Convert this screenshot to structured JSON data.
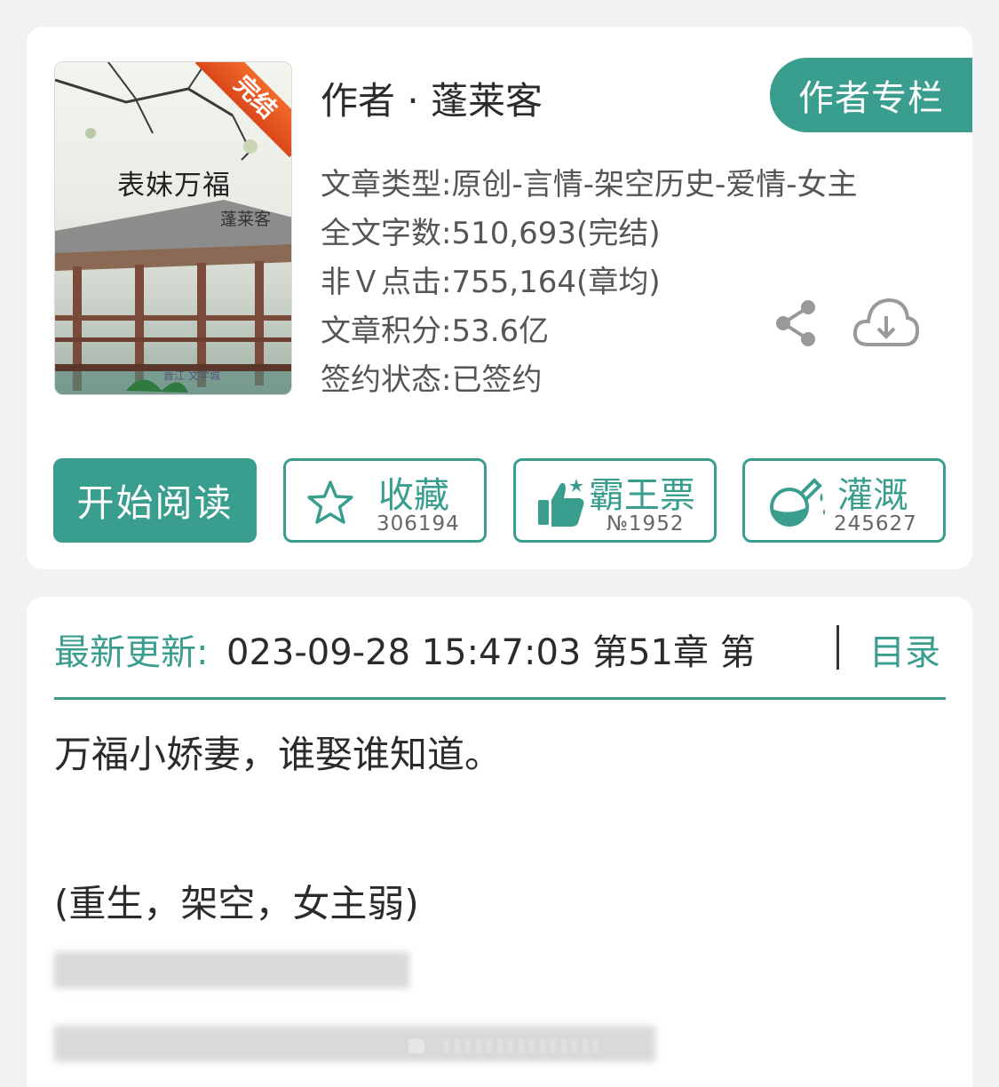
{
  "book": {
    "cover_title": "表妹万福",
    "cover_author": "蓬莱客",
    "cover_badge": "完结",
    "cover_logo": "晋江 文学城",
    "author_line": "作者 · 蓬莱客",
    "author_column_button": "作者专栏",
    "meta": [
      "文章类型:原创-言情-架空历史-爱情-女主",
      "全文字数:510,693(完结)",
      "非Ｖ点击:755,164(章均)",
      "文章积分:53.6亿",
      "签约状态:已签约"
    ]
  },
  "actions": {
    "read": "开始阅读",
    "favorite_label": "收藏",
    "favorite_count": "306194",
    "ticket_label": "霸王票",
    "ticket_count": "№1952",
    "water_label": "灌溉",
    "water_count": "245627"
  },
  "latest": {
    "label": "最新更新:",
    "value": "023-09-28 15:47:03   第51章 第",
    "catalog": "目录"
  },
  "intro": [
    "万福小娇妻，谁娶谁知道。",
    "(重生，架空，女主弱)"
  ],
  "colors": {
    "accent": "#3a9e8f",
    "badge": "#e85a24"
  },
  "icons": [
    "share-icon",
    "download-cloud-icon",
    "star-icon",
    "thumbs-up-icon",
    "flask-icon"
  ]
}
